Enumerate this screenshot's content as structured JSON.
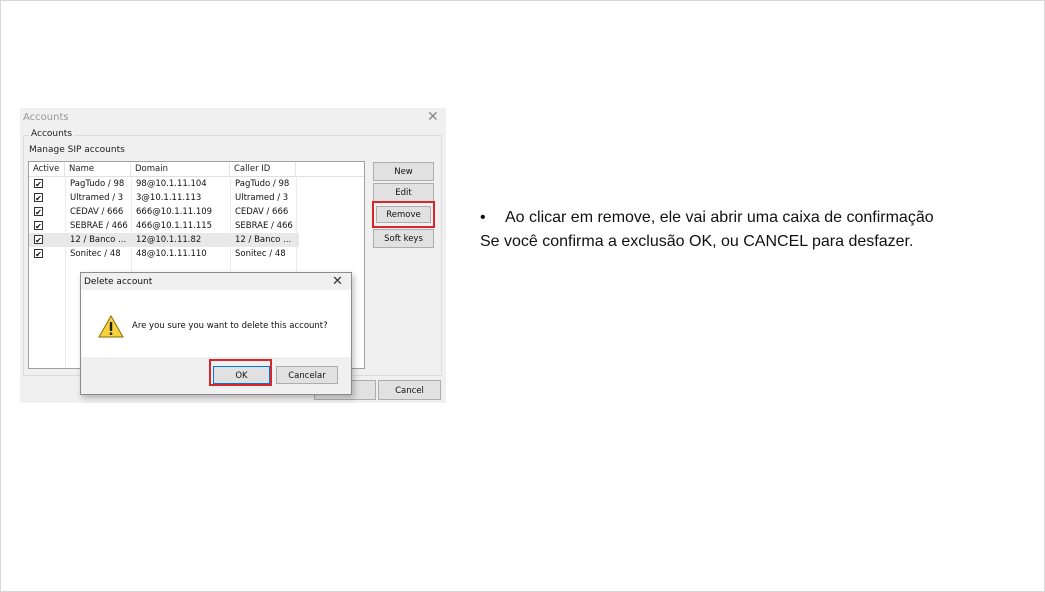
{
  "accounts_window": {
    "title": "Accounts",
    "group_label": "Accounts",
    "manage_label": "Manage SIP accounts",
    "columns": [
      "Active",
      "Name",
      "Domain",
      "Caller ID"
    ],
    "rows": [
      {
        "active": "✔",
        "name": "PagTudo / 98",
        "domain": "98@10.1.11.104",
        "caller_id": "PagTudo / 98"
      },
      {
        "active": "✔",
        "name": "Ultramed / 3",
        "domain": "3@10.1.11.113",
        "caller_id": "Ultramed / 3"
      },
      {
        "active": "✔",
        "name": "CEDAV / 666",
        "domain": "666@10.1.11.109",
        "caller_id": "CEDAV / 666"
      },
      {
        "active": "✔",
        "name": "SEBRAE / 466",
        "domain": "466@10.1.11.115",
        "caller_id": "SEBRAE / 466"
      },
      {
        "active": "✔",
        "name": "12 / Banco ...",
        "domain": "12@10.1.11.82",
        "caller_id": "12 / Banco ..."
      },
      {
        "active": "✔",
        "name": "Sonitec / 48",
        "domain": "48@10.1.11.110",
        "caller_id": "Sonitec / 48"
      }
    ],
    "buttons": {
      "new": "New",
      "edit": "Edit",
      "remove": "Remove",
      "soft_keys": "Soft keys",
      "cancel": "Cancel"
    },
    "close_glyph": "✕"
  },
  "delete_dialog": {
    "title": "Delete account",
    "message": "Are you sure you want to delete this account?",
    "ok": "OK",
    "cancel": "Cancelar",
    "close_glyph": "✕",
    "icon": "warning-icon"
  },
  "note": {
    "bullet": "•",
    "line1": "Ao clicar em remove, ele vai abrir uma caixa de confirmação",
    "line2": "Se você confirma a exclusão OK, ou CANCEL para desfazer."
  },
  "colors": {
    "highlight": "#d9262a",
    "window_bg": "#f0f0f0"
  }
}
